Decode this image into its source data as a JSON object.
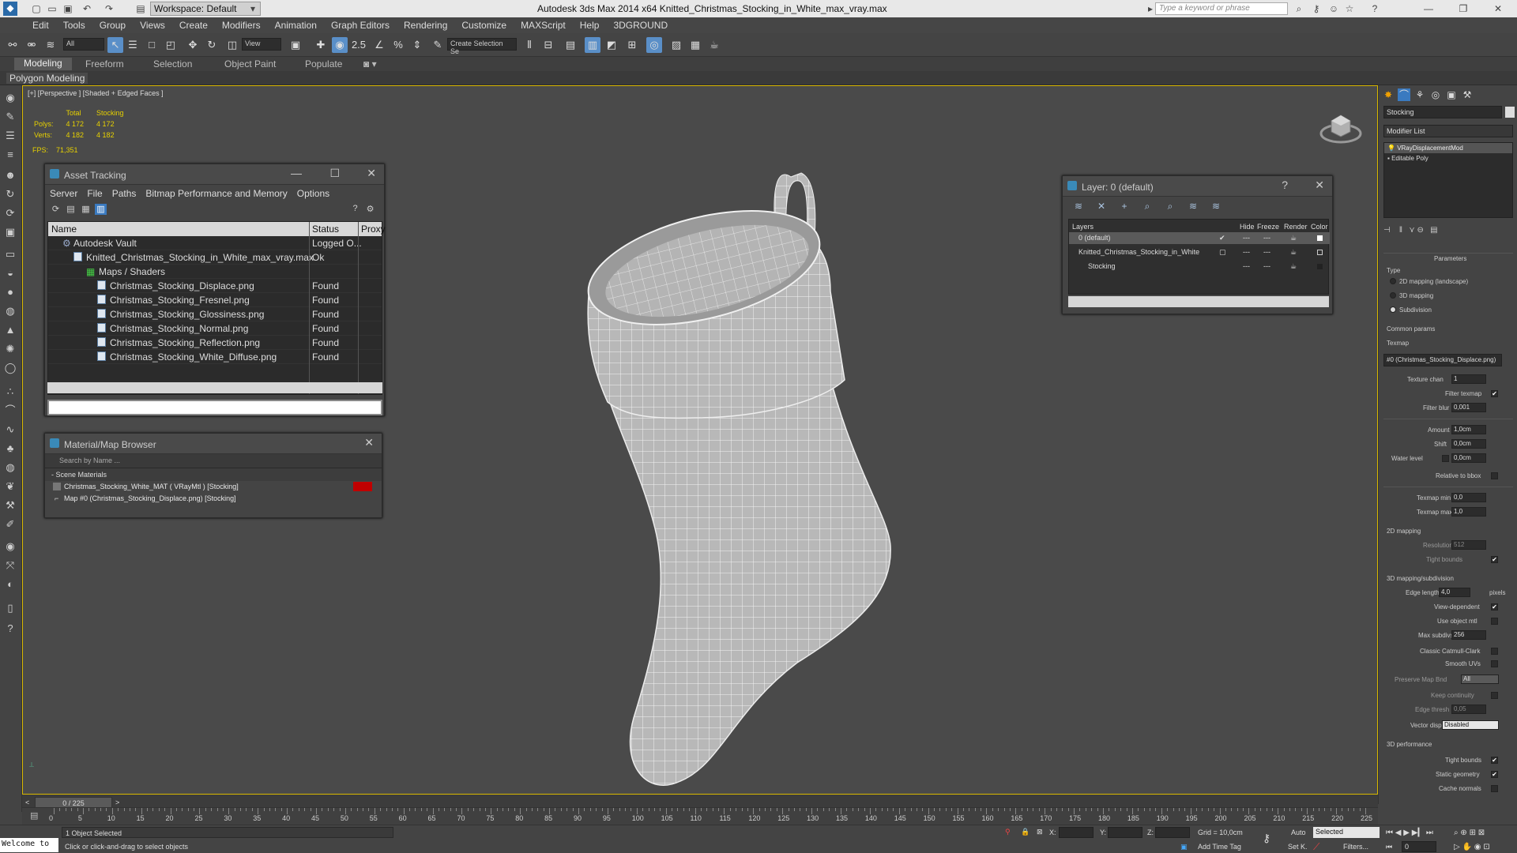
{
  "titlebar": {
    "workspace": "Workspace: Default",
    "title": "Autodesk 3ds Max  2014 x64     Knitted_Christmas_Stocking_in_White_max_vray.max",
    "search_placeholder": "Type a keyword or phrase"
  },
  "menu": [
    "Edit",
    "Tools",
    "Group",
    "Views",
    "Create",
    "Modifiers",
    "Animation",
    "Graph Editors",
    "Rendering",
    "Customize",
    "MAXScript",
    "Help",
    "3DGROUND"
  ],
  "toolbar": {
    "filter": "All",
    "view": "View",
    "selection_set": "Create Selection Se",
    "snap_label": "2.5"
  },
  "ribbon": {
    "tabs": [
      "Modeling",
      "Freeform",
      "Selection",
      "Object Paint",
      "Populate"
    ],
    "sub": "Polygon Modeling"
  },
  "viewport": {
    "label": "[+] [Perspective ] [Shaded + Edged Faces ]",
    "stats": {
      "col1": "Total",
      "col2": "Stocking",
      "polys_label": "Polys:",
      "polys_total": "4 172",
      "polys_obj": "4 172",
      "verts_label": "Verts:",
      "verts_total": "4 182",
      "verts_obj": "4 182",
      "fps_label": "FPS:",
      "fps": "71,351"
    }
  },
  "asset_tracking": {
    "title": "Asset Tracking",
    "menu": [
      "Server",
      "File",
      "Paths",
      "Bitmap Performance and Memory",
      "Options"
    ],
    "headers": [
      "Name",
      "Status",
      "Proxy"
    ],
    "rows": [
      {
        "name": "Autodesk Vault",
        "status": "Logged O..."
      },
      {
        "name": "Knitted_Christmas_Stocking_in_White_max_vray.max",
        "status": "Ok"
      },
      {
        "name": "Maps / Shaders",
        "status": ""
      },
      {
        "name": "Christmas_Stocking_Displace.png",
        "status": "Found"
      },
      {
        "name": "Christmas_Stocking_Fresnel.png",
        "status": "Found"
      },
      {
        "name": "Christmas_Stocking_Glossiness.png",
        "status": "Found"
      },
      {
        "name": "Christmas_Stocking_Normal.png",
        "status": "Found"
      },
      {
        "name": "Christmas_Stocking_Reflection.png",
        "status": "Found"
      },
      {
        "name": "Christmas_Stocking_White_Diffuse.png",
        "status": "Found"
      }
    ]
  },
  "material_browser": {
    "title": "Material/Map Browser",
    "search_placeholder": "Search by Name ...",
    "group": "- Scene Materials",
    "items": [
      "Christmas_Stocking_White_MAT ( VRayMtl ) [Stocking]",
      "Map #0 (Christmas_Stocking_Displace.png) [Stocking]"
    ]
  },
  "layer_window": {
    "title": "Layer: 0 (default)",
    "headers": [
      "Layers",
      "Hide",
      "Freeze",
      "Render",
      "Color"
    ],
    "rows": [
      "0 (default)",
      "Knitted_Christmas_Stocking_in_White",
      "Stocking"
    ]
  },
  "command_panel": {
    "object_name": "Stocking",
    "modifier_list": "Modifier List",
    "stack": [
      "VRayDisplacementMod",
      "Editable Poly"
    ],
    "rollout": "Parameters",
    "type_label": "Type",
    "types": [
      "2D mapping (landscape)",
      "3D mapping",
      "Subdivision"
    ],
    "common": "Common params",
    "texmap_label": "Texmap",
    "texmap": "#0 (Christmas_Stocking_Displace.png)",
    "texture_chan_label": "Texture chan",
    "texture_chan": "1",
    "filter_texmap": "Filter texmap",
    "filter_blur_label": "Filter blur",
    "filter_blur": "0,001",
    "amount_label": "Amount",
    "amount": "1,0cm",
    "shift_label": "Shift",
    "shift": "0,0cm",
    "water_level_label": "Water level",
    "water_level": "0,0cm",
    "relative_bbox": "Relative to bbox",
    "texmap_min_label": "Texmap min",
    "texmap_min": "0,0",
    "texmap_max_label": "Texmap max",
    "texmap_max": "1,0",
    "mapping2d": "2D mapping",
    "resolution_label": "Resolution",
    "resolution": "512",
    "tight_bounds": "Tight bounds",
    "mapping3d": "3D mapping/subdivision",
    "edge_length_label": "Edge length",
    "edge_length": "4,0",
    "pixels": "pixels",
    "view_dependent": "View-dependent",
    "use_object_mtl": "Use object mtl",
    "max_subdivs_label": "Max subdivs",
    "max_subdivs": "256",
    "classic_catmull": "Classic Catmull-Clark",
    "smooth_uvs": "Smooth UVs",
    "preserve_map_bnd_label": "Preserve Map Bnd",
    "preserve_map_bnd": "All",
    "keep_continuity": "Keep continuity",
    "edge_thresh_label": "Edge thresh",
    "edge_thresh": "0,05",
    "vector_displ_label": "Vector displ",
    "vector_displ": "Disabled",
    "perf": "3D performance",
    "tight_bounds2": "Tight bounds",
    "static_geometry": "Static geometry",
    "cache_normals": "Cache normals"
  },
  "timeline": {
    "frame": "0 / 225",
    "ticks": [
      "0",
      "5",
      "10",
      "15",
      "20",
      "25",
      "30",
      "35",
      "40",
      "45",
      "50",
      "55",
      "60",
      "65",
      "70",
      "75",
      "80",
      "85",
      "90",
      "95",
      "100",
      "105",
      "110",
      "115",
      "120",
      "125",
      "130",
      "135",
      "140",
      "145",
      "150",
      "155",
      "160",
      "165",
      "170",
      "175",
      "180",
      "185",
      "190",
      "195",
      "200",
      "205",
      "210",
      "215",
      "220",
      "225"
    ]
  },
  "status": {
    "welcome": "Welcome to",
    "selected": "1 Object Selected",
    "prompt": "Click or click-and-drag to select objects",
    "x": "X:",
    "y": "Y:",
    "z": "Z:",
    "grid": "Grid = 10,0cm",
    "add_time_tag": "Add Time Tag",
    "auto": "Auto",
    "selected_dd": "Selected",
    "setk": "Set K.",
    "filters": "Filters...",
    "frame": "0"
  },
  "colors": {
    "accent": "#5a8fc8",
    "viewport_border": "#d8b800",
    "stats": "#e6d000",
    "mat_swatch": "#c00000"
  }
}
